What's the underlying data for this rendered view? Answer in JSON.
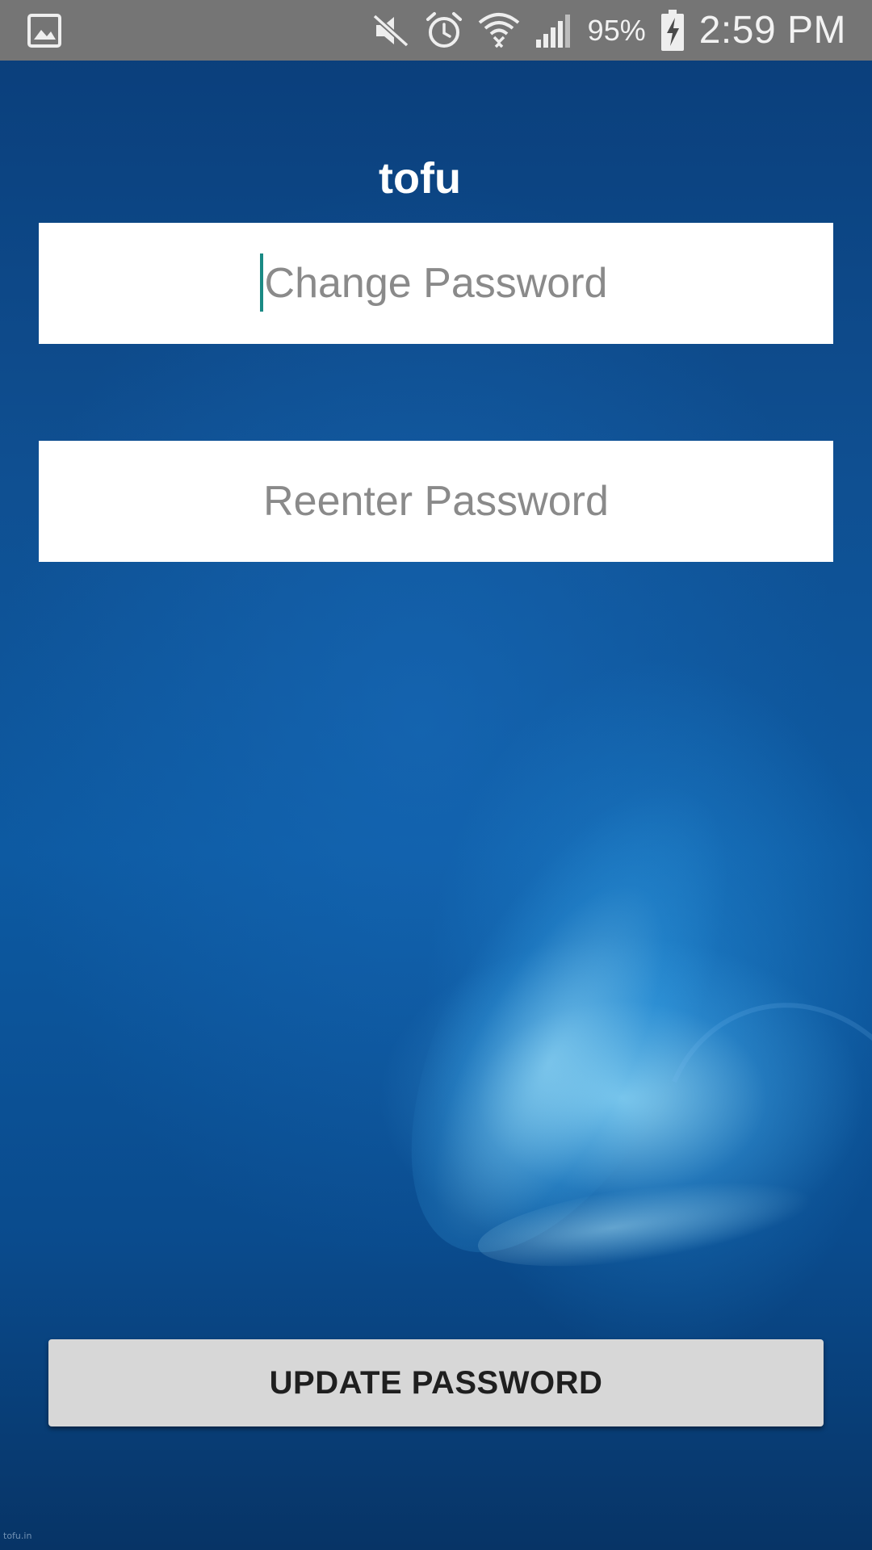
{
  "status_bar": {
    "battery_percent": "95%",
    "time": "2:59 PM",
    "icons": [
      "image-notification-icon",
      "mute-icon",
      "alarm-icon",
      "wifi-icon",
      "signal-icon",
      "battery-charging-icon"
    ]
  },
  "app": {
    "title": "tofu"
  },
  "form": {
    "change_password_placeholder": "Change Password",
    "reenter_password_placeholder": "Reenter Password",
    "update_button_label": "UPDATE PASSWORD"
  },
  "footer": {
    "watermark": "tofu.in"
  },
  "colors": {
    "status_bar": "#757575",
    "background_dark": "#0a3d79",
    "background_light": "#0d5aa2",
    "button": "#d7d7d7",
    "cursor": "#1a8a84"
  }
}
